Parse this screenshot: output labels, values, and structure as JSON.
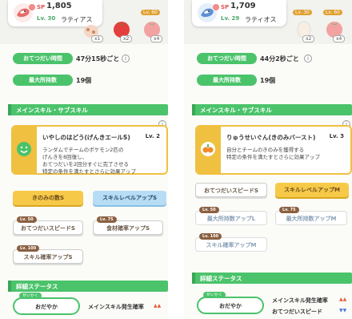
{
  "left": {
    "header": {
      "sp_label": "SP",
      "sp_value": "1,805",
      "level": "Lv. 30",
      "name": "ラティアス"
    },
    "ingredients": [
      {
        "lv": "",
        "count": "x1"
      },
      {
        "lv": "",
        "count": "x2"
      },
      {
        "lv": "Lv. 60",
        "count": "x4"
      }
    ],
    "stats": [
      {
        "label": "おてつだい時間",
        "value": "47分15秒ごと"
      },
      {
        "label": "最大所持数",
        "value": "19個"
      }
    ],
    "main_skill_section": "メインスキル・サブスキル",
    "skill": {
      "name": "いやしのはどう(げんきエールS)",
      "level": "Lv. 2",
      "description": "ランダムでチームのポケモン2匹の\nげんきを8回復し、\nおてつだいを2回分すぐに完了させる\n特定の条件を満たすとさらに効果アップ"
    },
    "subskills": [
      {
        "label": "きのみの数S",
        "style": "yellow",
        "lock": ""
      },
      {
        "label": "スキルレベルアップS",
        "style": "blue",
        "lock": ""
      },
      {
        "label": "おてつだいスピードS",
        "style": "white",
        "lock": "Lv. 50"
      },
      {
        "label": "食材確率アップS",
        "style": "white",
        "lock": "Lv. 75"
      },
      {
        "label": "スキル確率アップS",
        "style": "white",
        "lock": "Lv. 100"
      }
    ],
    "detail_section": "詳細ステータス",
    "nature_tag": "せいかく",
    "nature": "おだやか",
    "nature_stats": [
      {
        "label": "メインスキル発生確率",
        "arrows": "▲▲"
      }
    ]
  },
  "right": {
    "header": {
      "sp_label": "SP",
      "sp_value": "1,709",
      "level": "Lv. 29",
      "name": "ラティオス"
    },
    "ingredients": [
      {
        "lv": "Lv. 30",
        "count": "x2"
      },
      {
        "lv": "Lv. 60",
        "count": "x4"
      }
    ],
    "stats": [
      {
        "label": "おてつだい時間",
        "value": "44分2秒ごと"
      },
      {
        "label": "最大所持数",
        "value": "19個"
      }
    ],
    "main_skill_section": "メインスキル・サブスキル",
    "skill": {
      "name": "りゅうせいぐん(きのみバースト)",
      "level": "Lv. 3",
      "description": "自分とチームのきのみを獲得する\n特定の条件を満たすとさらに効果アップ"
    },
    "subskills": [
      {
        "label": "おてつだいスピードS",
        "style": "white",
        "lock": ""
      },
      {
        "label": "スキルレベルアップM",
        "style": "yellow",
        "lock": ""
      },
      {
        "label": "最大所持数アップL",
        "style": "locked",
        "lock": "Lv. 50"
      },
      {
        "label": "最大所持数アップM",
        "style": "locked",
        "lock": "Lv. 75"
      },
      {
        "label": "スキル確率アップM",
        "style": "locked",
        "lock": "Lv. 100"
      }
    ],
    "detail_section": "詳細ステータス",
    "nature_tag": "せいかく",
    "nature": "おだやか",
    "nature_stats": [
      {
        "label": "メインスキル発生確率",
        "arrows": "▲▲"
      },
      {
        "label": "おてつだいスピード",
        "arrows": "▼▼"
      }
    ]
  },
  "colors": {
    "accent_green": "#4bc36b",
    "skill_yellow": "#f0c040",
    "subskill_blue": "#b7ddf5"
  }
}
